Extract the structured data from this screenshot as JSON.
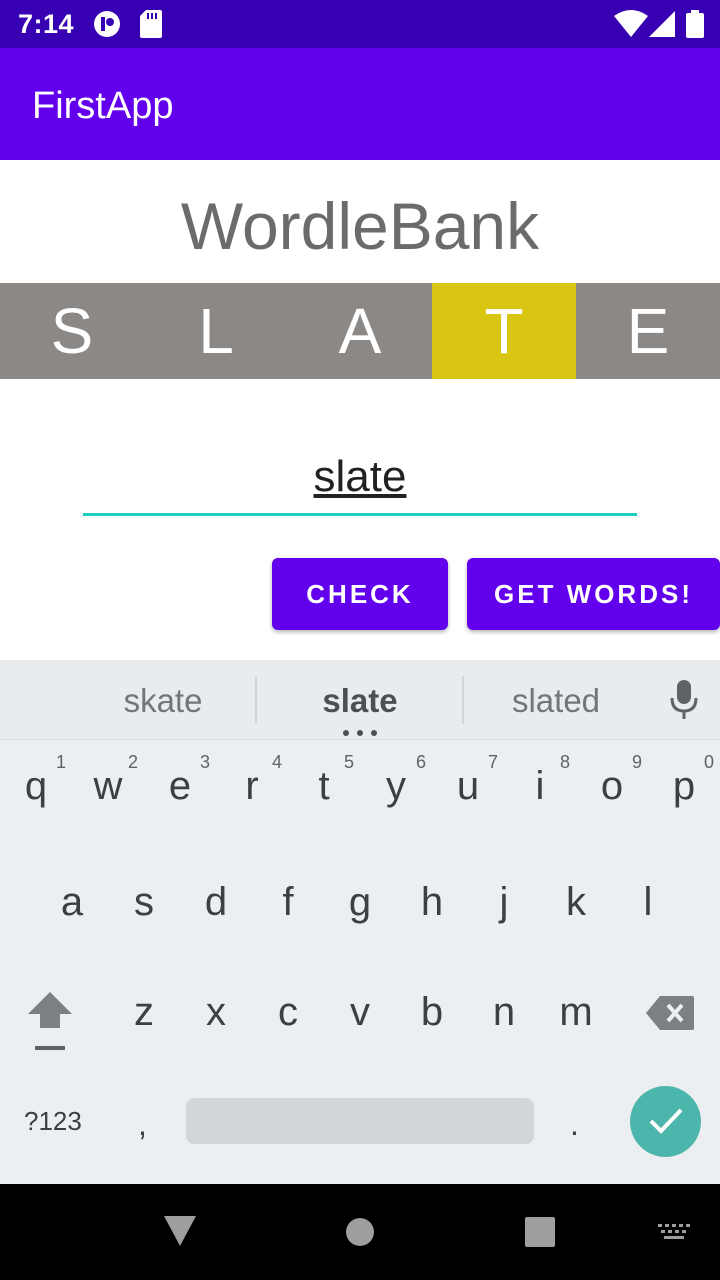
{
  "status_bar": {
    "time": "7:14",
    "icons_left": [
      "notification-icon",
      "sd-card-icon"
    ],
    "icons_right": [
      "wifi-icon",
      "signal-icon",
      "battery-icon"
    ]
  },
  "app_bar": {
    "title": "FirstApp"
  },
  "headline": "WordleBank",
  "tiles": [
    {
      "letter": "S",
      "color": "#8b8886"
    },
    {
      "letter": "L",
      "color": "#8b8886"
    },
    {
      "letter": "A",
      "color": "#8b8886"
    },
    {
      "letter": "T",
      "color": "#d9c512"
    },
    {
      "letter": "E",
      "color": "#8b8886"
    }
  ],
  "input": {
    "value": "slate"
  },
  "buttons": {
    "check": "CHECK",
    "get_words": "GET WORDS!"
  },
  "keyboard": {
    "suggestions": [
      "skate",
      "slate",
      "slated"
    ],
    "row1": [
      {
        "key": "q",
        "hint": "1"
      },
      {
        "key": "w",
        "hint": "2"
      },
      {
        "key": "e",
        "hint": "3"
      },
      {
        "key": "r",
        "hint": "4"
      },
      {
        "key": "t",
        "hint": "5"
      },
      {
        "key": "y",
        "hint": "6"
      },
      {
        "key": "u",
        "hint": "7"
      },
      {
        "key": "i",
        "hint": "8"
      },
      {
        "key": "o",
        "hint": "9"
      },
      {
        "key": "p",
        "hint": "0"
      }
    ],
    "row2": [
      "a",
      "s",
      "d",
      "f",
      "g",
      "h",
      "j",
      "k",
      "l"
    ],
    "row3": [
      "z",
      "x",
      "c",
      "v",
      "b",
      "n",
      "m"
    ],
    "symbols_label": "?123",
    "comma": ",",
    "period": "."
  },
  "colors": {
    "accent": "#6200ee",
    "status_bar": "#3700b3",
    "present": "#d9c512",
    "absent": "#8b8886",
    "input_line": "#1ccfbe"
  }
}
